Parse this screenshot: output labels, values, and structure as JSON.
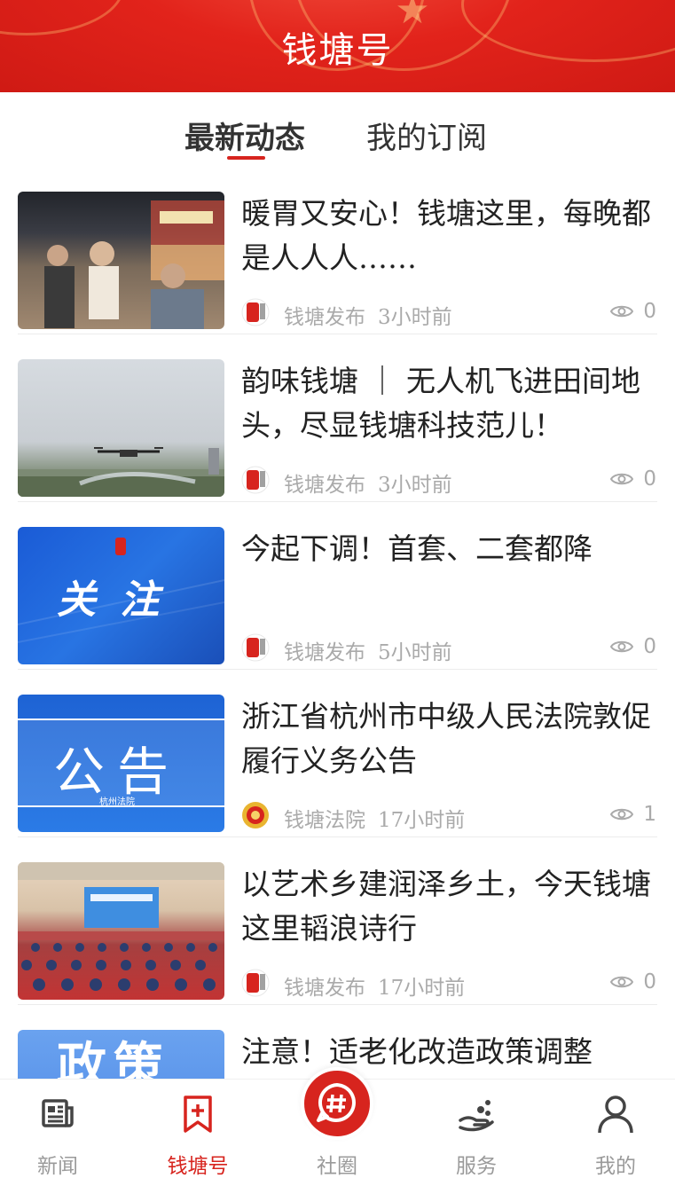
{
  "header": {
    "title": "钱塘号"
  },
  "tabs": [
    {
      "label": "最新动态",
      "active": true
    },
    {
      "label": "我的订阅",
      "active": false
    }
  ],
  "feed": [
    {
      "title": "暖胃又安心！钱塘这里，每晚都是人人人……",
      "source": "钱塘发布",
      "time": "3小时前",
      "views": "0",
      "thumb": "night-market-photo"
    },
    {
      "title": "韵味钱塘 ｜ 无人机飞进田间地头，尽显钱塘科技范儿！",
      "source": "钱塘发布",
      "time": "3小时前",
      "views": "0",
      "thumb": "drone-field-photo"
    },
    {
      "title": "今起下调！首套、二套都降",
      "source": "钱塘发布",
      "time": "5小时前",
      "views": "0",
      "thumb": "guanzhu-banner",
      "thumb_text": "关 注"
    },
    {
      "title": "浙江省杭州市中级人民法院敦促履行义务公告",
      "source": "钱塘法院",
      "time": "17小时前",
      "views": "1",
      "thumb": "notice-banner",
      "thumb_text": "公告",
      "thumb_sub": "杭州法院"
    },
    {
      "title": "以艺术乡建润泽乡土，今天钱塘这里韬浪诗行",
      "source": "钱塘发布",
      "time": "17小时前",
      "views": "0",
      "thumb": "conference-hall-photo"
    },
    {
      "title": "注意！适老化改造政策调整",
      "source": "",
      "time": "",
      "views": "",
      "thumb": "policy-banner",
      "thumb_text": "政策"
    }
  ],
  "bottom_nav": [
    {
      "label": "新闻",
      "icon": "newspaper-icon",
      "active": false
    },
    {
      "label": "钱塘号",
      "icon": "bookmark-plus-icon",
      "active": true
    },
    {
      "label": "社圈",
      "icon": "hash-chat-icon",
      "active": false
    },
    {
      "label": "服务",
      "icon": "hand-service-icon",
      "active": false
    },
    {
      "label": "我的",
      "icon": "person-icon",
      "active": false
    }
  ],
  "colors": {
    "brand_red": "#d7241e",
    "muted_gray": "#aaaaaa"
  }
}
